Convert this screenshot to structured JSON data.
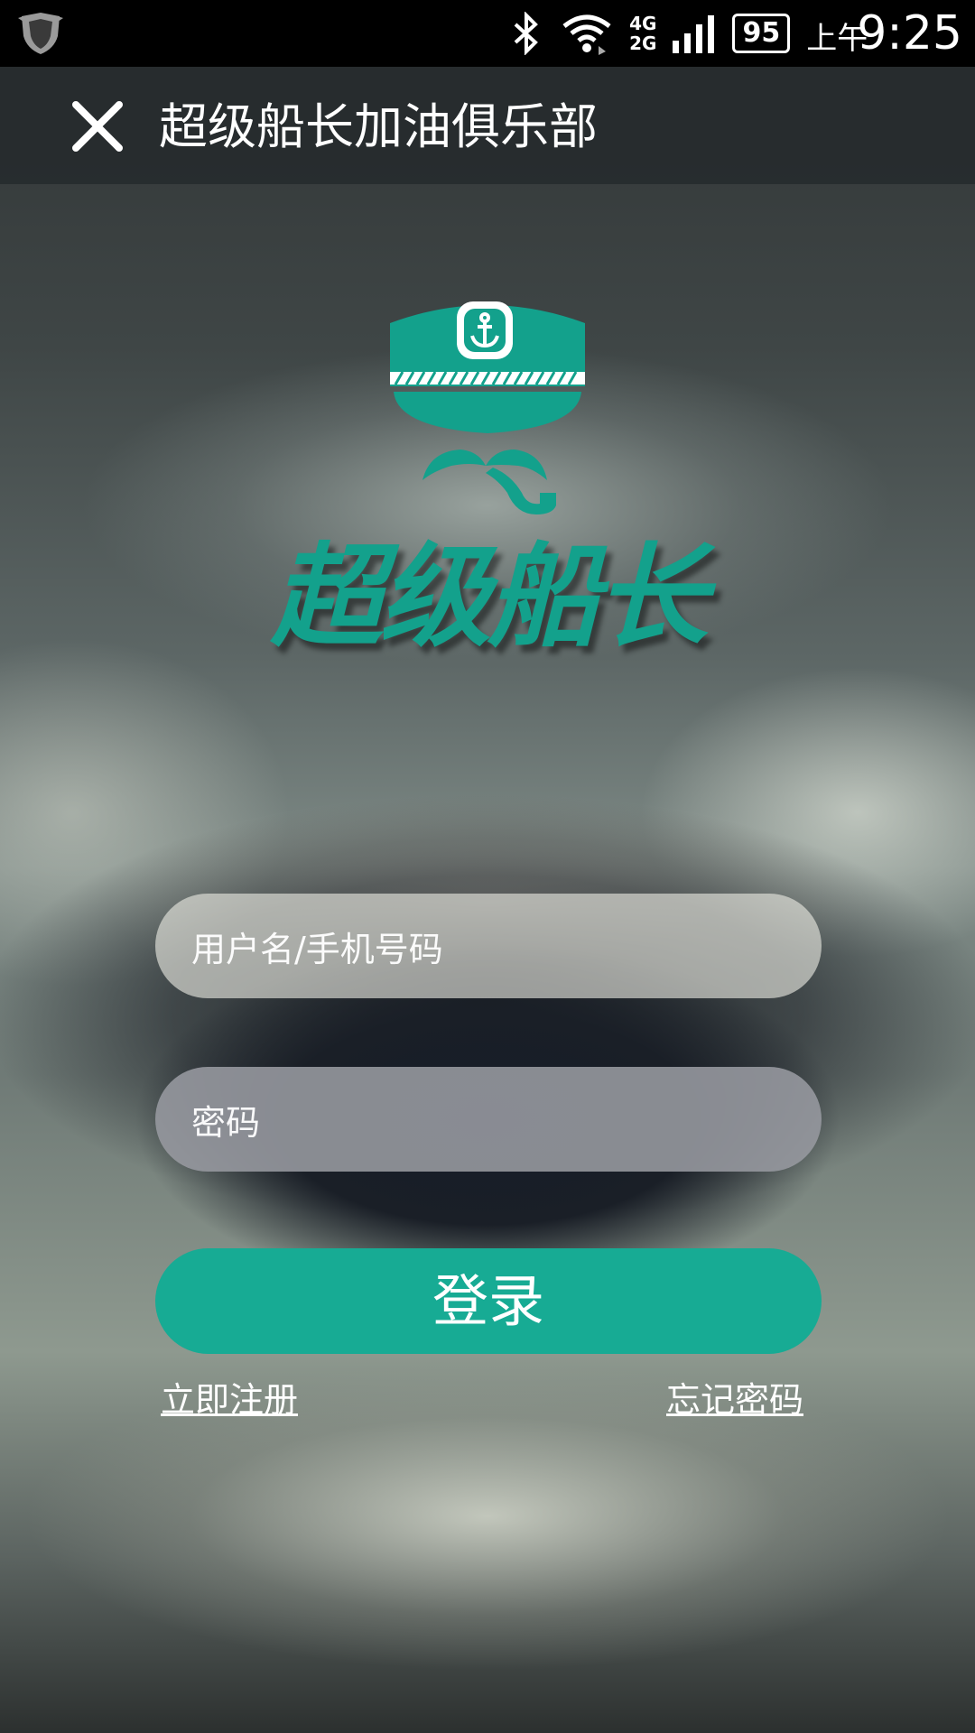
{
  "status_bar": {
    "left_icon": "shield-icon",
    "network": [
      "4G",
      "2G"
    ],
    "battery": "95",
    "time_prefix": "上午",
    "time": "9:25"
  },
  "toolbar": {
    "close_icon": "close-icon",
    "title": "超级船长加油俱乐部"
  },
  "logo": {
    "text": "超级船长",
    "icon": "captain-hat-logo",
    "brand_color": "#13a18c"
  },
  "form": {
    "username_placeholder": "用户名/手机号码",
    "password_placeholder": "密码",
    "login_label": "登录",
    "register_label": "立即注册",
    "forgot_label": "忘记密码"
  },
  "colors": {
    "accent": "#17ab94",
    "statusbar": "#000000",
    "toolbar": "#262b2e"
  }
}
